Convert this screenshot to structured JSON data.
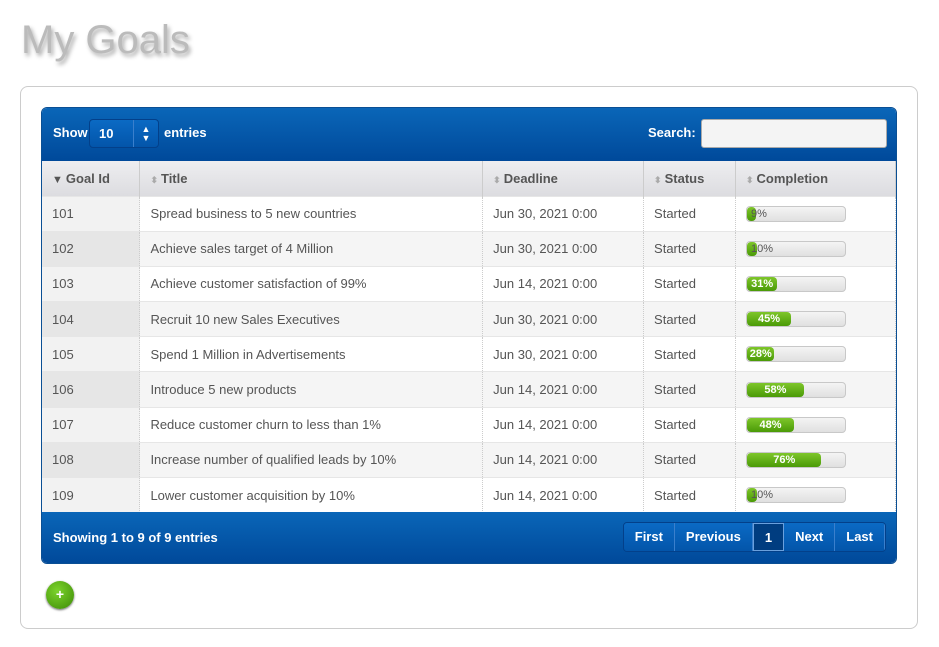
{
  "page_title": "My Goals",
  "controls": {
    "show_label": "Show",
    "page_size": "10",
    "entries_label": "entries",
    "search_label": "Search:",
    "search_value": ""
  },
  "columns": [
    "Goal Id",
    "Title",
    "Deadline",
    "Status",
    "Completion"
  ],
  "sort": {
    "column": "Goal Id",
    "direction": "descending-indicator"
  },
  "rows": [
    {
      "id": "101",
      "title": "Spread business to 5 new countries",
      "deadline": "Jun 30, 2021 0:00",
      "status": "Started",
      "completion": 9,
      "completion_label": "9%"
    },
    {
      "id": "102",
      "title": "Achieve sales target of 4 Million",
      "deadline": "Jun 30, 2021 0:00",
      "status": "Started",
      "completion": 10,
      "completion_label": "10%"
    },
    {
      "id": "103",
      "title": "Achieve customer satisfaction of 99%",
      "deadline": "Jun 14, 2021 0:00",
      "status": "Started",
      "completion": 31,
      "completion_label": "31%"
    },
    {
      "id": "104",
      "title": "Recruit 10 new Sales Executives",
      "deadline": "Jun 30, 2021 0:00",
      "status": "Started",
      "completion": 45,
      "completion_label": "45%"
    },
    {
      "id": "105",
      "title": "Spend 1 Million in Advertisements",
      "deadline": "Jun 30, 2021 0:00",
      "status": "Started",
      "completion": 28,
      "completion_label": "28%"
    },
    {
      "id": "106",
      "title": "Introduce 5 new products",
      "deadline": "Jun 14, 2021 0:00",
      "status": "Started",
      "completion": 58,
      "completion_label": "58%"
    },
    {
      "id": "107",
      "title": "Reduce customer churn to less than 1%",
      "deadline": "Jun 14, 2021 0:00",
      "status": "Started",
      "completion": 48,
      "completion_label": "48%"
    },
    {
      "id": "108",
      "title": "Increase number of qualified leads by 10%",
      "deadline": "Jun 14, 2021 0:00",
      "status": "Started",
      "completion": 76,
      "completion_label": "76%"
    },
    {
      "id": "109",
      "title": "Lower customer acquisition by 10%",
      "deadline": "Jun 14, 2021 0:00",
      "status": "Started",
      "completion": 10,
      "completion_label": "10%"
    }
  ],
  "footer": {
    "info": "Showing 1 to 9 of 9 entries",
    "pager": [
      "First",
      "Previous",
      "1",
      "Next",
      "Last"
    ],
    "current_page": "1"
  },
  "add_button": {
    "label": "+",
    "icon": "plus-icon"
  },
  "colors": {
    "header_blue": "#00499a",
    "progress_green": "#5aab0c"
  }
}
